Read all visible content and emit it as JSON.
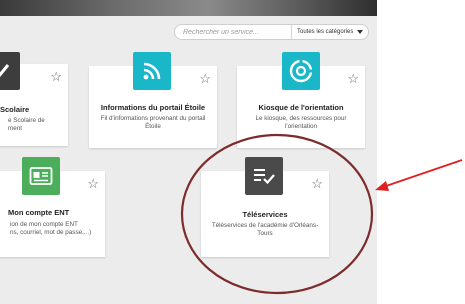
{
  "search": {
    "placeholder": "Rechercher un service...",
    "category_label": "Toutes les catégories"
  },
  "cards": {
    "scolaire": {
      "title": "Scolaire",
      "desc_line1": "e Scolaire de",
      "desc_line2": "ment"
    },
    "infos": {
      "title": "Informations du portail Étoile",
      "desc_line1": "Fil d'informations provenant du portail",
      "desc_line2": "Étoile"
    },
    "kiosque": {
      "title": "Kiosque de l'orientation",
      "desc_line1": "Le kiosque, des ressources pour",
      "desc_line2": "l'orientation"
    },
    "compte": {
      "title": "Mon compte ENT",
      "desc_line1": "ion de mon compte ENT",
      "desc_line2": "ns, courriel, mot de passe,...)"
    },
    "teleservices": {
      "title": "Téléservices",
      "desc_line1": "Téléservices de l'académie d'Orléans-",
      "desc_line2": "Tours"
    }
  },
  "colors": {
    "wifi_tile": "#1ab7c8",
    "orientation_tile": "#1ab7c8",
    "account_tile": "#4cae5b",
    "teleservices_tile": "#4a4a4a",
    "circle": "#7d2b2b",
    "arrow": "#e02020"
  },
  "icons": {
    "infos": "rss-icon",
    "kiosque": "compass-icon",
    "compte": "id-card-icon",
    "teleservices": "checklist-icon",
    "star": "star-outline-icon"
  }
}
